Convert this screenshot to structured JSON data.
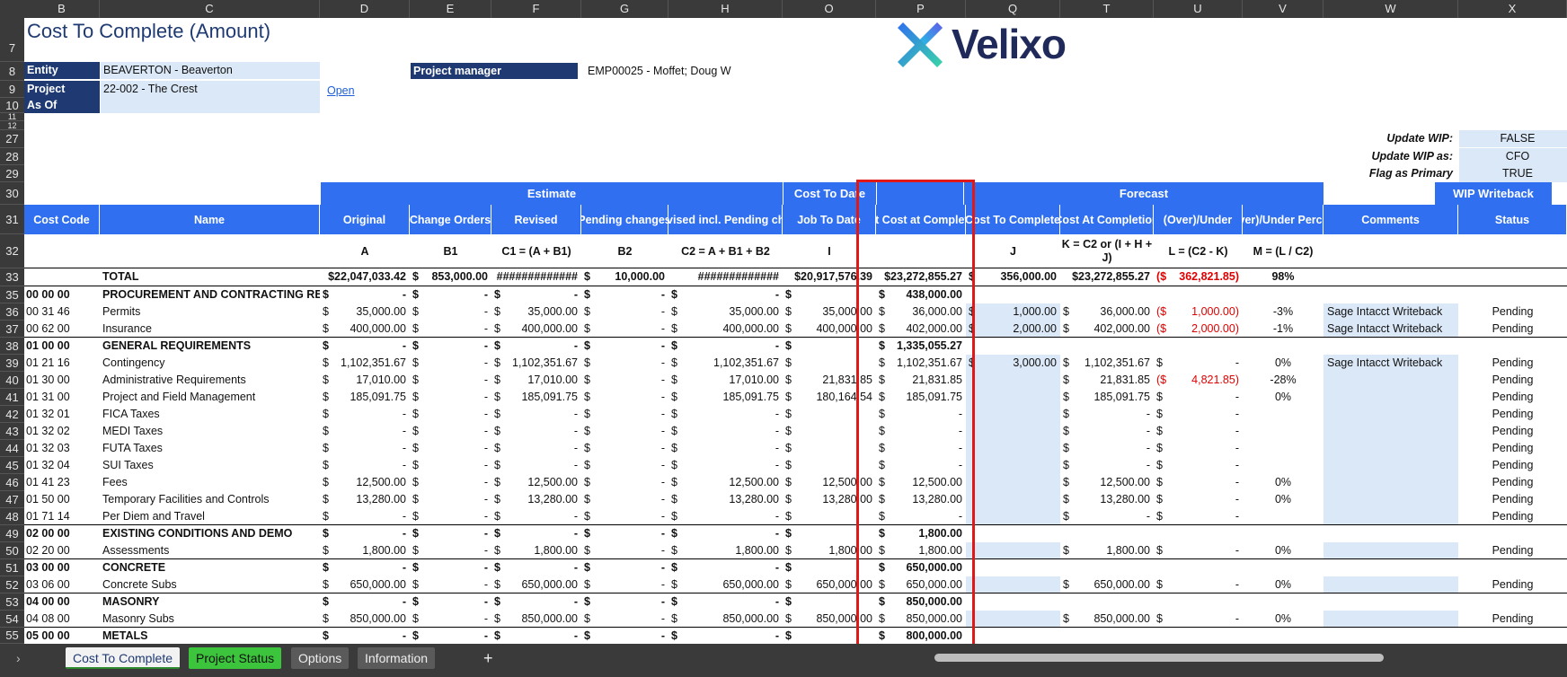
{
  "columns": [
    "B",
    "C",
    "D",
    "E",
    "F",
    "G",
    "H",
    "O",
    "P",
    "Q",
    "T",
    "U",
    "V",
    "W",
    "X"
  ],
  "row_numbers": [
    "7",
    "8",
    "9",
    "10",
    "11",
    "12",
    "27",
    "28",
    "29",
    "30",
    "31",
    "32",
    "33",
    "35",
    "36",
    "37",
    "38",
    "39",
    "40",
    "41",
    "42",
    "43",
    "44",
    "45",
    "46",
    "47",
    "48",
    "49",
    "50",
    "51",
    "52",
    "53",
    "54",
    "55"
  ],
  "title": "Cost To Complete (Amount)",
  "brand": "Velixo",
  "fields": {
    "entity_label": "Entity",
    "entity_value": "BEAVERTON - Beaverton",
    "project_label": "Project",
    "project_value": "22-002 - The Crest",
    "asof_label": "As Of",
    "asof_value": "",
    "open_link": "Open",
    "pm_label": "Project manager",
    "pm_value": "EMP00025 - Moffet; Doug W"
  },
  "settings": [
    {
      "label": "Update WIP:",
      "value": "FALSE"
    },
    {
      "label": "Update WIP as:",
      "value": "CFO"
    },
    {
      "label": "Flag as Primary",
      "value": "TRUE"
    }
  ],
  "bands": {
    "estimate": "Estimate",
    "cost_to_date": "Cost To Date",
    "forecast": "Forecast",
    "wip": "WIP Writeback"
  },
  "headers": [
    "Cost Code",
    "Name",
    "Original",
    "Change Orders",
    "Revised",
    "Pending changes",
    "Revised incl. Pending chgs",
    "Job To Date",
    "Last Cost at Completion",
    "Cost To Complete",
    "Cost At Completion",
    "(Over)/Under",
    "(Over)/Under Percent",
    "Comments",
    "Status"
  ],
  "formulas": [
    "",
    "",
    "A",
    "B1",
    "C1 = (A + B1)",
    "B2",
    "C2 = A + B1 + B2",
    "I",
    "",
    "J",
    "K = C2 or (I + H + J)",
    "L = (C2 - K)",
    "M = (L / C2)",
    "",
    ""
  ],
  "total": {
    "name": "TOTAL",
    "d": "$22,047,033.42",
    "e": "853,000.00",
    "f": "#############",
    "g": "10,000.00",
    "h": "#############",
    "o": "$20,917,576.39",
    "p": "$23,272,855.27",
    "q": "356,000.00",
    "t": "$23,272,855.27",
    "u": "362,821.85",
    "v": "98%"
  },
  "rows": [
    {
      "code": "00 00 00",
      "name": "PROCUREMENT AND CONTRACTING REQ",
      "bold": true,
      "d": "-",
      "e": "-",
      "f": "-",
      "g": "-",
      "h": "-",
      "o": "",
      "p": "438,000.00",
      "q": "",
      "t": "",
      "u": "",
      "v": "",
      "w": "",
      "x": ""
    },
    {
      "code": "00 31 46",
      "name": "Permits",
      "d": "35,000.00",
      "e": "-",
      "f": "35,000.00",
      "g": "-",
      "h": "35,000.00",
      "o": "35,000.00",
      "p": "36,000.00",
      "q": "1,000.00",
      "t": "36,000.00",
      "u": "1,000.00",
      "uneg": true,
      "v": "-3%",
      "w": "Sage Intacct Writeback",
      "x": "Pending"
    },
    {
      "code": "00 62 00",
      "name": "Insurance",
      "d": "400,000.00",
      "e": "-",
      "f": "400,000.00",
      "g": "-",
      "h": "400,000.00",
      "o": "400,000.00",
      "p": "402,000.00",
      "q": "2,000.00",
      "t": "402,000.00",
      "u": "2,000.00",
      "uneg": true,
      "v": "-1%",
      "w": "Sage Intacct Writeback",
      "x": "Pending"
    },
    {
      "code": "01 00 00",
      "name": "GENERAL REQUIREMENTS",
      "bold": true,
      "d": "-",
      "e": "-",
      "f": "-",
      "g": "-",
      "h": "-",
      "o": "",
      "p": "1,335,055.27",
      "q": "",
      "t": "",
      "u": "",
      "v": "",
      "w": "",
      "x": ""
    },
    {
      "code": "01 21 16",
      "name": "Contingency",
      "d": "1,102,351.67",
      "e": "-",
      "f": "1,102,351.67",
      "g": "-",
      "h": "1,102,351.67",
      "o": "",
      "p": "1,102,351.67",
      "q": "3,000.00",
      "t": "1,102,351.67",
      "u": "-",
      "v": "0%",
      "w": "Sage Intacct Writeback",
      "x": "Pending"
    },
    {
      "code": "01 30 00",
      "name": "Administrative Requirements",
      "d": "17,010.00",
      "e": "-",
      "f": "17,010.00",
      "g": "-",
      "h": "17,010.00",
      "o": "21,831.85",
      "p": "21,831.85",
      "q": "",
      "t": "21,831.85",
      "u": "4,821.85",
      "uneg": true,
      "v": "-28%",
      "w": "",
      "x": "Pending"
    },
    {
      "code": "01 31 00",
      "name": "Project and Field Management",
      "d": "185,091.75",
      "e": "-",
      "f": "185,091.75",
      "g": "-",
      "h": "185,091.75",
      "o": "180,164.54",
      "p": "185,091.75",
      "q": "",
      "t": "185,091.75",
      "u": "-",
      "v": "0%",
      "w": "",
      "x": "Pending"
    },
    {
      "code": "01 32 01",
      "name": "FICA Taxes",
      "d": "-",
      "e": "-",
      "f": "-",
      "g": "-",
      "h": "-",
      "o": "",
      "p": "-",
      "q": "",
      "t": "-",
      "u": "-",
      "v": "",
      "w": "",
      "x": "Pending"
    },
    {
      "code": "01 32 02",
      "name": "MEDI Taxes",
      "d": "-",
      "e": "-",
      "f": "-",
      "g": "-",
      "h": "-",
      "o": "",
      "p": "-",
      "q": "",
      "t": "-",
      "u": "-",
      "v": "",
      "w": "",
      "x": "Pending"
    },
    {
      "code": "01 32 03",
      "name": "FUTA Taxes",
      "d": "-",
      "e": "-",
      "f": "-",
      "g": "-",
      "h": "-",
      "o": "",
      "p": "-",
      "q": "",
      "t": "-",
      "u": "-",
      "v": "",
      "w": "",
      "x": "Pending"
    },
    {
      "code": "01 32 04",
      "name": "SUI Taxes",
      "d": "-",
      "e": "-",
      "f": "-",
      "g": "-",
      "h": "-",
      "o": "",
      "p": "-",
      "q": "",
      "t": "-",
      "u": "-",
      "v": "",
      "w": "",
      "x": "Pending"
    },
    {
      "code": "01 41 23",
      "name": "Fees",
      "d": "12,500.00",
      "e": "-",
      "f": "12,500.00",
      "g": "-",
      "h": "12,500.00",
      "o": "12,500.00",
      "p": "12,500.00",
      "q": "",
      "t": "12,500.00",
      "u": "-",
      "v": "0%",
      "w": "",
      "x": "Pending"
    },
    {
      "code": "01 50 00",
      "name": "Temporary Facilities and Controls",
      "d": "13,280.00",
      "e": "-",
      "f": "13,280.00",
      "g": "-",
      "h": "13,280.00",
      "o": "13,280.00",
      "p": "13,280.00",
      "q": "",
      "t": "13,280.00",
      "u": "-",
      "v": "0%",
      "w": "",
      "x": "Pending"
    },
    {
      "code": "01 71 14",
      "name": "Per Diem and Travel",
      "d": "-",
      "e": "-",
      "f": "-",
      "g": "-",
      "h": "-",
      "o": "",
      "p": "-",
      "q": "",
      "t": "-",
      "u": "-",
      "v": "",
      "w": "",
      "x": "Pending"
    },
    {
      "code": "02 00 00",
      "name": "EXISTING CONDITIONS AND DEMO",
      "bold": true,
      "d": "-",
      "e": "-",
      "f": "-",
      "g": "-",
      "h": "-",
      "o": "",
      "p": "1,800.00",
      "q": "",
      "t": "",
      "u": "",
      "v": "",
      "w": "",
      "x": ""
    },
    {
      "code": "02 20 00",
      "name": "Assessments",
      "d": "1,800.00",
      "e": "-",
      "f": "1,800.00",
      "g": "-",
      "h": "1,800.00",
      "o": "1,800.00",
      "p": "1,800.00",
      "q": "",
      "t": "1,800.00",
      "u": "-",
      "v": "0%",
      "w": "",
      "x": "Pending"
    },
    {
      "code": "03 00 00",
      "name": "CONCRETE",
      "bold": true,
      "d": "-",
      "e": "-",
      "f": "-",
      "g": "-",
      "h": "-",
      "o": "",
      "p": "650,000.00",
      "q": "",
      "t": "",
      "u": "",
      "v": "",
      "w": "",
      "x": ""
    },
    {
      "code": "03 06 00",
      "name": "Concrete Subs",
      "d": "650,000.00",
      "e": "-",
      "f": "650,000.00",
      "g": "-",
      "h": "650,000.00",
      "o": "650,000.00",
      "p": "650,000.00",
      "q": "",
      "t": "650,000.00",
      "u": "-",
      "v": "0%",
      "w": "",
      "x": "Pending"
    },
    {
      "code": "04 00 00",
      "name": "MASONRY",
      "bold": true,
      "d": "-",
      "e": "-",
      "f": "-",
      "g": "-",
      "h": "-",
      "o": "",
      "p": "850,000.00",
      "q": "",
      "t": "",
      "u": "",
      "v": "",
      "w": "",
      "x": ""
    },
    {
      "code": "04 08 00",
      "name": "Masonry Subs",
      "d": "850,000.00",
      "e": "-",
      "f": "850,000.00",
      "g": "-",
      "h": "850,000.00",
      "o": "850,000.00",
      "p": "850,000.00",
      "q": "",
      "t": "850,000.00",
      "u": "-",
      "v": "0%",
      "w": "",
      "x": "Pending"
    },
    {
      "code": "05 00 00",
      "name": "METALS",
      "bold": true,
      "d": "-",
      "e": "-",
      "f": "-",
      "g": "-",
      "h": "-",
      "o": "",
      "p": "800,000.00",
      "q": "",
      "t": "",
      "u": "",
      "v": "",
      "w": "",
      "x": ""
    }
  ],
  "tabs": [
    "Cost To Complete",
    "Project Status",
    "Options",
    "Information"
  ],
  "tab_add": "+",
  "tab_nav": "›",
  "dollar": "$",
  "neg_prefix": "($",
  "neg_suffix": ")"
}
